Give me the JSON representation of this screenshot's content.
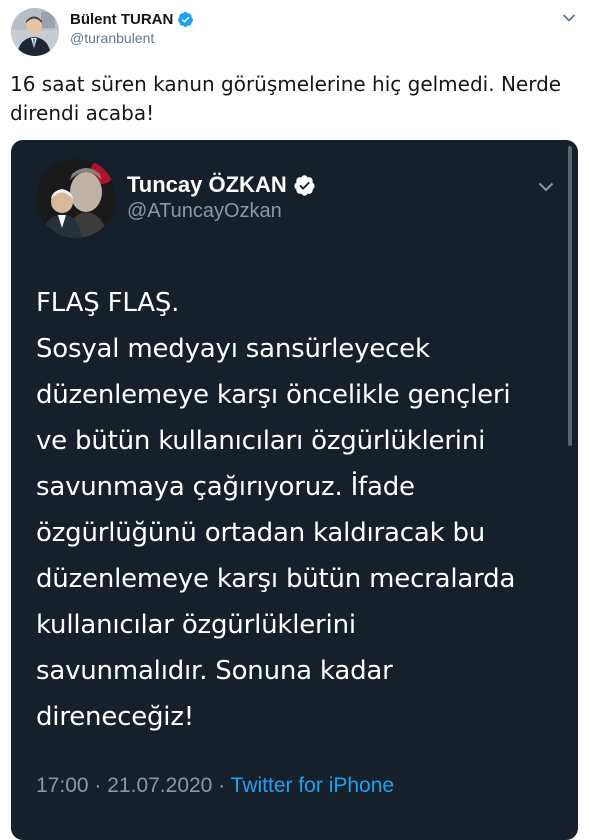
{
  "outer_tweet": {
    "author_name": "Bülent TURAN",
    "author_handle": "@turanbulent",
    "text": "16 saat süren kanun görüşmelerine hiç gelmedi. Nerde direndi acaba!",
    "colors": {
      "text": "#14171a",
      "secondary": "#657786",
      "verified": "#1da1f2"
    },
    "icons": {
      "verified": "verified-badge-icon",
      "more": "chevron-down-icon"
    }
  },
  "embedded_tweet": {
    "author_name": "Tuncay ÖZKAN",
    "author_handle": "@ATuncayOzkan",
    "text_lines": [
      "FLAŞ FLAŞ.",
      "Sosyal medyayı sansürleyecek",
      "düzenlemeye karşı öncelikle gençleri",
      "ve bütün kullanıcıları özgürlüklerini",
      "savunmaya çağırıyoruz. İfade",
      "özgürlüğünü ortadan kaldıracak bu",
      "düzenlemeye karşı bütün mecralarda",
      "kullanıcılar özgürlüklerini",
      "savunmalıdır. Sonuna kadar",
      "direneceğiz!"
    ],
    "time": "17:00",
    "separator": "·",
    "date": "21.07.2020",
    "source": "Twitter for iPhone",
    "colors": {
      "background": "#15202b",
      "text": "#ffffff",
      "secondary": "#8899a6",
      "link": "#1da1f2"
    },
    "icons": {
      "verified": "verified-badge-icon",
      "more": "chevron-down-icon"
    }
  }
}
